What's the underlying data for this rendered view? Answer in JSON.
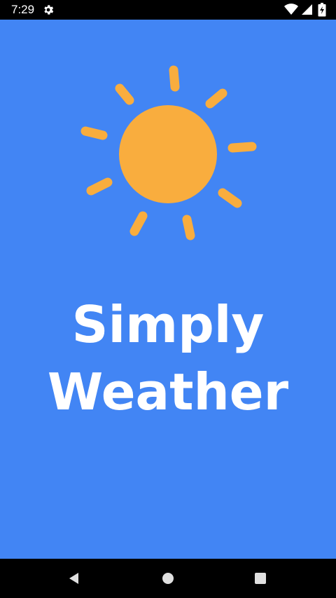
{
  "status_bar": {
    "time": "7:29",
    "icons": [
      "settings-icon",
      "wifi-icon",
      "cellular-signal-icon",
      "battery-icon"
    ]
  },
  "splash": {
    "logo_icon": "sun-icon",
    "title_line_1": "Simply",
    "title_line_2": "Weather"
  },
  "nav_bar": {
    "icons": [
      "back-icon",
      "home-icon",
      "recents-icon"
    ]
  },
  "colors": {
    "background": "#4285f4",
    "sun": "#f9ad3e",
    "title_text": "#ffffff",
    "system_bars": "#000000"
  }
}
